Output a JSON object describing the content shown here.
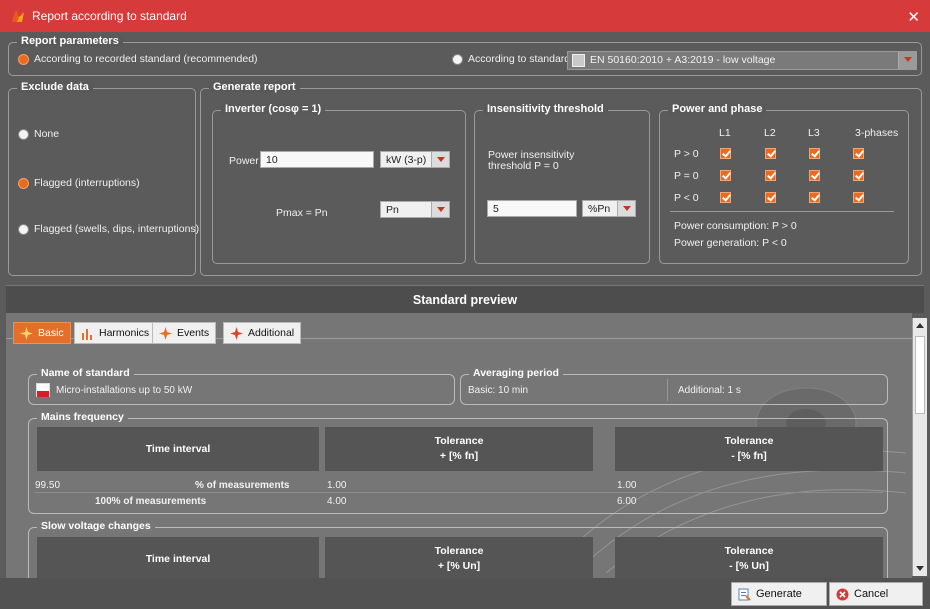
{
  "window": {
    "title": "Report according to standard",
    "close_label": "✕"
  },
  "report_parameters": {
    "title": "Report parameters",
    "option_recorded": "According to recorded standard (recommended)",
    "option_standard": "According to standard:",
    "standard_value": "EN 50160:2010 + A3:2019 - low voltage"
  },
  "exclude_data": {
    "title": "Exclude data",
    "options": [
      "None",
      "Flagged (interruptions)",
      "Flagged (swells, dips, interruptions)"
    ],
    "selected": 1
  },
  "generate_report": {
    "title": "Generate report",
    "inverter": {
      "title": "Inverter (cosφ = 1)",
      "power_label": "Power",
      "power_value": "10",
      "power_unit": "kW (3-p)",
      "pmax_label": "Pmax = Pn",
      "pmax_value": "Pn"
    },
    "threshold": {
      "title": "Insensitivity threshold",
      "desc_line1": "Power insensitivity",
      "desc_line2": "threshold P = 0",
      "value": "5",
      "unit": "%Pn"
    },
    "power_phase": {
      "title": "Power and phase",
      "columns": [
        "L1",
        "L2",
        "L3",
        "3-phases"
      ],
      "rows": [
        "P > 0",
        "P = 0",
        "P < 0"
      ],
      "note1": "Power consumption: P > 0",
      "note2": "Power generation: P < 0"
    }
  },
  "preview": {
    "title": "Standard preview",
    "tabs": [
      "Basic",
      "Harmonics",
      "Events",
      "Additional"
    ],
    "active_tab": 0,
    "name_of_standard": {
      "title": "Name of standard",
      "value": "Micro-installations up to 50 kW"
    },
    "averaging": {
      "title": "Averaging period",
      "basic": "Basic: 10 min",
      "additional": "Additional: 1 s"
    },
    "mains_frequency": {
      "title": "Mains frequency",
      "col_time": "Time interval",
      "col_plus_1": "Tolerance",
      "col_plus_2": "+ [% fn]",
      "col_minus_1": "Tolerance",
      "col_minus_2": "- [% fn]",
      "rows": [
        {
          "value": "99.50",
          "label": "% of measurements",
          "plus": "1.00",
          "minus": "1.00"
        },
        {
          "value": "",
          "label": "100% of measurements",
          "plus": "4.00",
          "minus": "6.00"
        }
      ]
    },
    "slow_voltage": {
      "title": "Slow voltage changes",
      "col_time": "Time interval",
      "col_plus_1": "Tolerance",
      "col_plus_2": "+ [% Un]",
      "col_minus_1": "Tolerance",
      "col_minus_2": "- [% Un]"
    }
  },
  "buttons": {
    "generate": "Generate",
    "cancel": "Cancel"
  }
}
